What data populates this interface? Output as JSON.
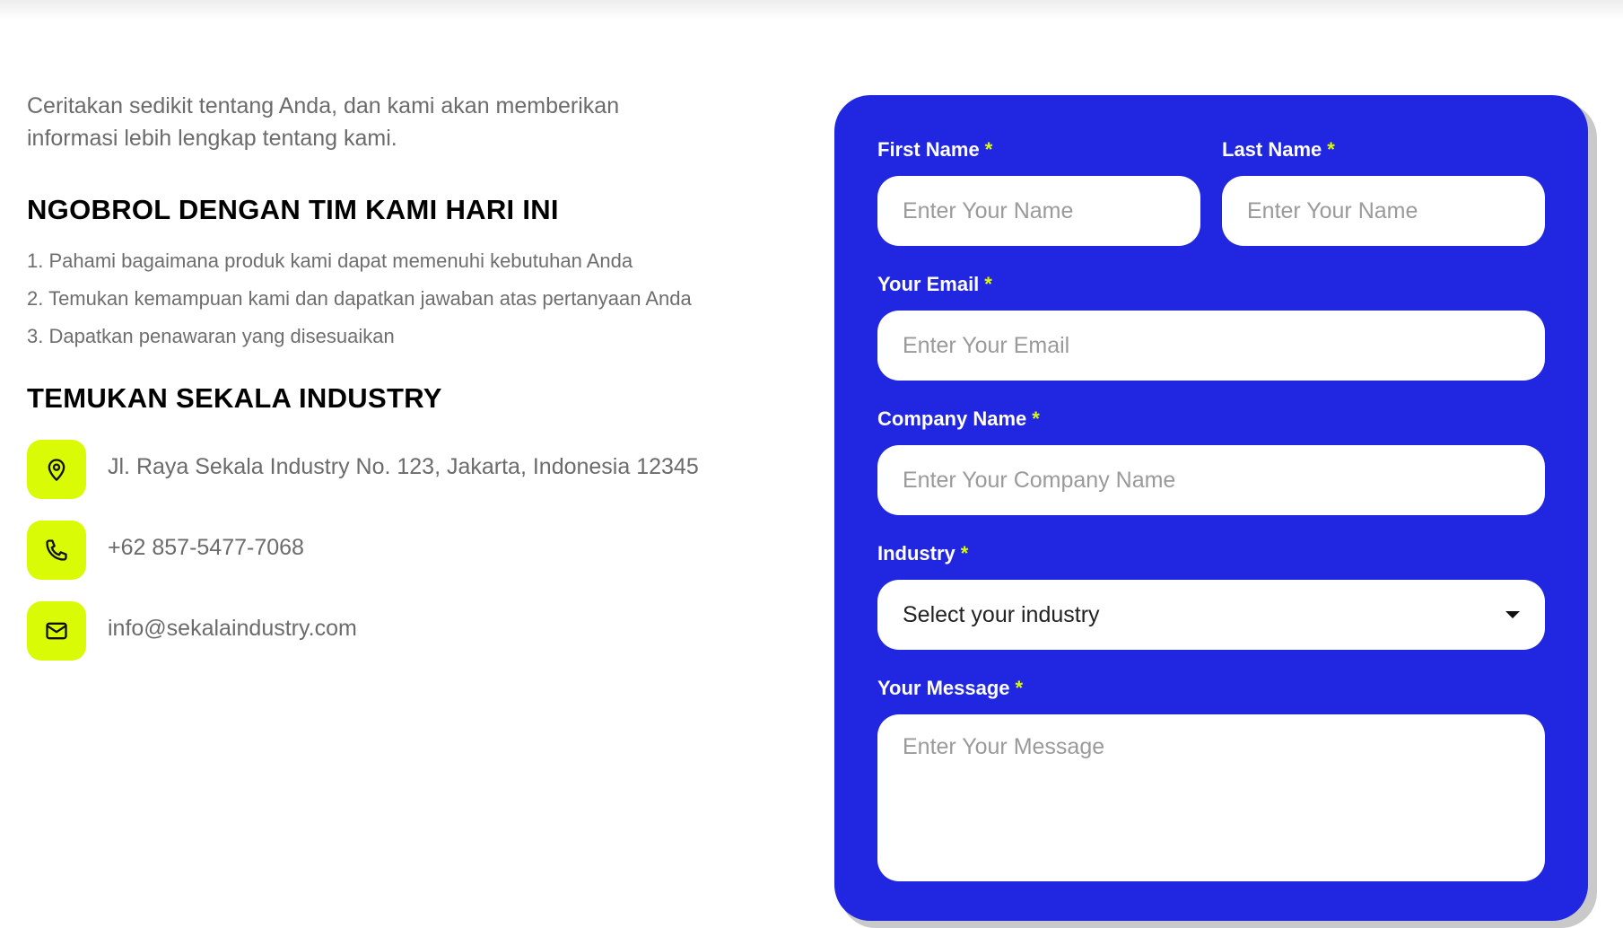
{
  "intro": {
    "text": "Ceritakan sedikit tentang Anda, dan kami akan memberikan informasi lebih lengkap tentang kami."
  },
  "chat_section": {
    "heading": "NGOBROL DENGAN TIM KAMI HARI INI",
    "steps": [
      "1. Pahami bagaimana produk kami dapat memenuhi kebutuhan Anda",
      "2. Temukan kemampuan kami dan dapatkan jawaban atas pertanyaan Anda",
      "3. Dapatkan penawaran yang disesuaikan"
    ]
  },
  "find_section": {
    "heading": "TEMUKAN SEKALA INDUSTRY",
    "address": "Jl. Raya Sekala Industry No. 123, Jakarta, Indonesia 12345",
    "phone": "+62 857-5477-7068",
    "email": "info@sekalaindustry.com",
    "icons": [
      "location-pin-icon",
      "phone-icon",
      "mail-icon"
    ]
  },
  "form": {
    "required_marker": "*",
    "first_name": {
      "label": "First Name",
      "placeholder": "Enter Your Name"
    },
    "last_name": {
      "label": "Last Name",
      "placeholder": "Enter Your Name"
    },
    "email": {
      "label": "Your Email",
      "placeholder": "Enter Your Email"
    },
    "company": {
      "label": "Company Name",
      "placeholder": "Enter Your Company Name"
    },
    "industry": {
      "label": "Industry",
      "selected": "Select your industry"
    },
    "message": {
      "label": "Your Message",
      "placeholder": "Enter Your Message"
    }
  },
  "colors": {
    "card_bg": "#2127e0",
    "accent": "#d9fb06",
    "text_gray": "#6b6b6b"
  }
}
